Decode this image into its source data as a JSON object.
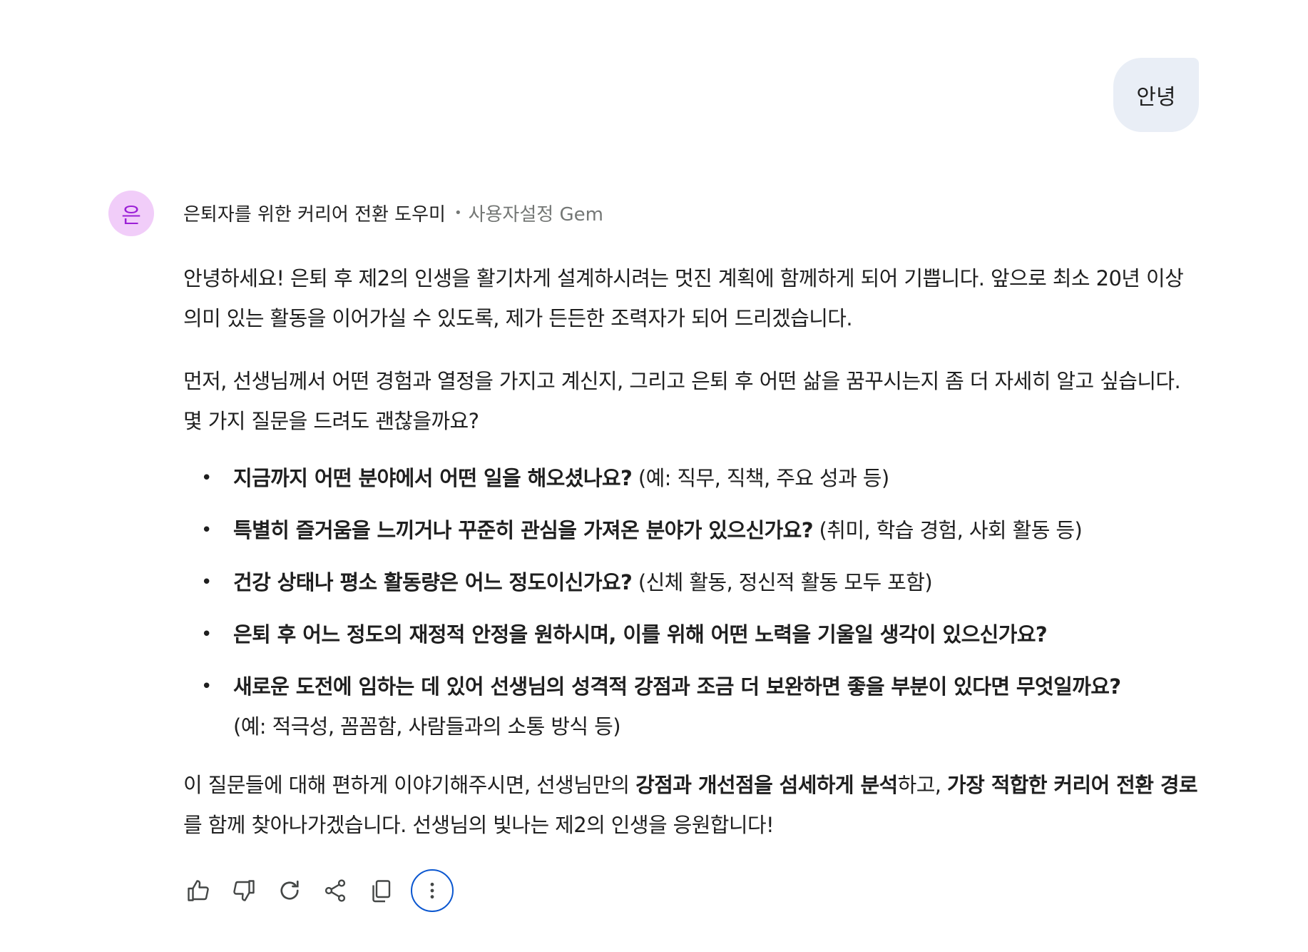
{
  "user_message": "안녕",
  "gem": {
    "avatar_letter": "은",
    "name": "은퇴자를 위한 커리어 전환 도우미",
    "separator": "•",
    "tag": "사용자설정 Gem"
  },
  "response": {
    "para1": "안녕하세요! 은퇴 후 제2의 인생을 활기차게 설계하시려는 멋진 계획에 함께하게 되어 기쁩니다. 앞으로 최소 20년 이상 의미 있는 활동을 이어가실 수 있도록, 제가 든든한 조력자가 되어 드리겠습니다.",
    "para2": "먼저, 선생님께서 어떤 경험과 열정을 가지고 계신지, 그리고 은퇴 후 어떤 삶을 꿈꾸시는지 좀 더 자세히 알고 싶습니다. 몇 가지 질문을 드려도 괜찮을까요?",
    "questions": [
      {
        "bullet": "•",
        "bold": "지금까지 어떤 분야에서 어떤 일을 해오셨나요?",
        "note": " (예: 직무, 직책, 주요 성과 등)"
      },
      {
        "bullet": "•",
        "bold": "특별히 즐거움을 느끼거나 꾸준히 관심을 가져온 분야가 있으신가요?",
        "note": " (취미, 학습 경험, 사회 활동 등)"
      },
      {
        "bullet": "•",
        "bold": "건강 상태나 평소 활동량은 어느 정도이신가요?",
        "note": " (신체 활동, 정신적 활동 모두 포함)"
      },
      {
        "bullet": "•",
        "bold": "은퇴 후 어느 정도의 재정적 안정을 원하시며, 이를 위해 어떤 노력을 기울일 생각이 있으신가요?",
        "note": ""
      },
      {
        "bullet": "•",
        "bold": "새로운 도전에 임하는 데 있어 선생님의 성격적 강점과 조금 더 보완하면 좋을 부분이 있다면 무엇일까요?",
        "note": " (예: 적극성, 꼼꼼함, 사람들과의 소통 방식 등)"
      }
    ],
    "closing": {
      "t1": "이 질문들에 대해 편하게 이야기해주시면, 선생님만의 ",
      "b1": "강점과 개선점을 섬세하게 분석",
      "t2": "하고, ",
      "b2": "가장 적합한 커리어 전환 경로",
      "t3": "를 함께 찾아나가겠습니다. 선생님의 빛나는 제2의 인생을 응원합니다!"
    }
  },
  "actions": [
    {
      "icon": "thumb-up-icon"
    },
    {
      "icon": "thumb-down-icon"
    },
    {
      "icon": "regenerate-icon"
    },
    {
      "icon": "share-icon"
    },
    {
      "icon": "copy-icon"
    },
    {
      "icon": "more-vert-icon"
    }
  ],
  "colors": {
    "user_bubble": "#e9eef6",
    "avatar_bg": "#f1cdf9",
    "avatar_fg": "#9b1fd6",
    "focus_ring": "#0b57d0",
    "muted_text": "#747775"
  }
}
